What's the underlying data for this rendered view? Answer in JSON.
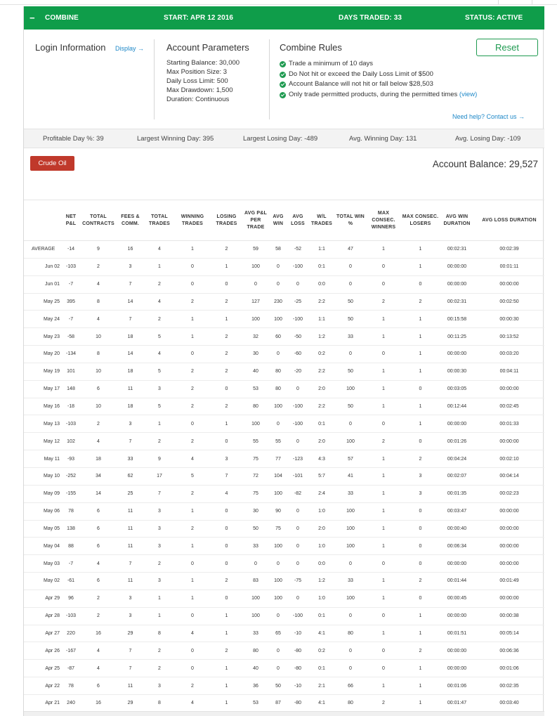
{
  "header": {
    "toggle_symbol": "−",
    "program": "COMBINE",
    "start": "START: APR 12 2016",
    "days_traded": "DAYS TRADED: 33",
    "status": "STATUS: ACTIVE"
  },
  "login": {
    "title": "Login Information",
    "display_link": "Display →"
  },
  "params": {
    "title": "Account Parameters",
    "lines": [
      "Starting Balance: 30,000",
      "Max Position Size: 3",
      "Daily Loss Limit: 500",
      "Max Drawdown: 1,500",
      "Duration: Continuous"
    ]
  },
  "rules": {
    "title": "Combine Rules",
    "items": [
      "Trade a minimum of 10 days",
      "Do Not hit or exceed the Daily Loss Limit of $500",
      "Account Balance will not hit or fall below $28,503",
      "Only trade permitted products, during the permitted times"
    ],
    "view_link": "(view)",
    "help_link": "Need help? Contact us →",
    "reset_label": "Reset"
  },
  "stats": {
    "profitable_day": "Profitable Day %: 39",
    "largest_win": "Largest Winning Day: 395",
    "largest_loss": "Largest Losing Day: -489",
    "avg_win": "Avg. Winning Day: 131",
    "avg_loss": "Avg. Losing Day: -109"
  },
  "product_button": "Crude Oil",
  "account_balance": "Account Balance: 29,527",
  "columns": [
    "",
    "NET P&L",
    "TOTAL CONTRACTS",
    "FEES & COMM.",
    "TOTAL TRADES",
    "WINNING TRADES",
    "LOSING TRADES",
    "AVG P&L PER TRADE",
    "AVG WIN",
    "AVG LOSS",
    "W/L TRADES",
    "TOTAL WIN %",
    "MAX CONSEC. WINNERS",
    "MAX CONSEC. LOSERS",
    "AVG WIN DURATION",
    "AVG LOSS DURATION"
  ],
  "rows": [
    [
      "AVERAGE",
      "-14",
      "9",
      "16",
      "4",
      "1",
      "2",
      "59",
      "58",
      "-52",
      "1:1",
      "47",
      "1",
      "1",
      "00:02:31",
      "00:02:39"
    ],
    [
      "Jun 02",
      "-103",
      "2",
      "3",
      "1",
      "0",
      "1",
      "100",
      "0",
      "-100",
      "0:1",
      "0",
      "0",
      "1",
      "00:00:00",
      "00:01:11"
    ],
    [
      "Jun 01",
      "-7",
      "4",
      "7",
      "2",
      "0",
      "0",
      "0",
      "0",
      "0",
      "0:0",
      "0",
      "0",
      "0",
      "00:00:00",
      "00:00:00"
    ],
    [
      "May 25",
      "395",
      "8",
      "14",
      "4",
      "2",
      "2",
      "127",
      "230",
      "-25",
      "2:2",
      "50",
      "2",
      "2",
      "00:02:31",
      "00:02:50"
    ],
    [
      "May 24",
      "-7",
      "4",
      "7",
      "2",
      "1",
      "1",
      "100",
      "100",
      "-100",
      "1:1",
      "50",
      "1",
      "1",
      "00:15:58",
      "00:00:30"
    ],
    [
      "May 23",
      "-58",
      "10",
      "18",
      "5",
      "1",
      "2",
      "32",
      "60",
      "-50",
      "1:2",
      "33",
      "1",
      "1",
      "00:11:25",
      "00:13:52"
    ],
    [
      "May 20",
      "-134",
      "8",
      "14",
      "4",
      "0",
      "2",
      "30",
      "0",
      "-60",
      "0:2",
      "0",
      "0",
      "1",
      "00:00:00",
      "00:03:20"
    ],
    [
      "May 19",
      "101",
      "10",
      "18",
      "5",
      "2",
      "2",
      "40",
      "80",
      "-20",
      "2:2",
      "50",
      "1",
      "1",
      "00:00:30",
      "00:04:11"
    ],
    [
      "May 17",
      "148",
      "6",
      "11",
      "3",
      "2",
      "0",
      "53",
      "80",
      "0",
      "2:0",
      "100",
      "1",
      "0",
      "00:03:05",
      "00:00:00"
    ],
    [
      "May 16",
      "-18",
      "10",
      "18",
      "5",
      "2",
      "2",
      "80",
      "100",
      "-100",
      "2:2",
      "50",
      "1",
      "1",
      "00:12:44",
      "00:02:45"
    ],
    [
      "May 13",
      "-103",
      "2",
      "3",
      "1",
      "0",
      "1",
      "100",
      "0",
      "-100",
      "0:1",
      "0",
      "0",
      "1",
      "00:00:00",
      "00:01:33"
    ],
    [
      "May 12",
      "102",
      "4",
      "7",
      "2",
      "2",
      "0",
      "55",
      "55",
      "0",
      "2:0",
      "100",
      "2",
      "0",
      "00:01:26",
      "00:00:00"
    ],
    [
      "May 11",
      "-93",
      "18",
      "33",
      "9",
      "4",
      "3",
      "75",
      "77",
      "-123",
      "4:3",
      "57",
      "1",
      "2",
      "00:04:24",
      "00:02:10"
    ],
    [
      "May 10",
      "-252",
      "34",
      "62",
      "17",
      "5",
      "7",
      "72",
      "104",
      "-101",
      "5:7",
      "41",
      "1",
      "3",
      "00:02:07",
      "00:04:14"
    ],
    [
      "May 09",
      "-155",
      "14",
      "25",
      "7",
      "2",
      "4",
      "75",
      "100",
      "-82",
      "2:4",
      "33",
      "1",
      "3",
      "00:01:35",
      "00:02:23"
    ],
    [
      "May 06",
      "78",
      "6",
      "11",
      "3",
      "1",
      "0",
      "30",
      "90",
      "0",
      "1:0",
      "100",
      "1",
      "0",
      "00:03:47",
      "00:00:00"
    ],
    [
      "May 05",
      "138",
      "6",
      "11",
      "3",
      "2",
      "0",
      "50",
      "75",
      "0",
      "2:0",
      "100",
      "1",
      "0",
      "00:00:40",
      "00:00:00"
    ],
    [
      "May 04",
      "88",
      "6",
      "11",
      "3",
      "1",
      "0",
      "33",
      "100",
      "0",
      "1:0",
      "100",
      "1",
      "0",
      "00:06:34",
      "00:00:00"
    ],
    [
      "May 03",
      "-7",
      "4",
      "7",
      "2",
      "0",
      "0",
      "0",
      "0",
      "0",
      "0:0",
      "0",
      "0",
      "0",
      "00:00:00",
      "00:00:00"
    ],
    [
      "May 02",
      "-61",
      "6",
      "11",
      "3",
      "1",
      "2",
      "83",
      "100",
      "-75",
      "1:2",
      "33",
      "1",
      "2",
      "00:01:44",
      "00:01:49"
    ],
    [
      "Apr 29",
      "96",
      "2",
      "3",
      "1",
      "1",
      "0",
      "100",
      "100",
      "0",
      "1:0",
      "100",
      "1",
      "0",
      "00:00:45",
      "00:00:00"
    ],
    [
      "Apr 28",
      "-103",
      "2",
      "3",
      "1",
      "0",
      "1",
      "100",
      "0",
      "-100",
      "0:1",
      "0",
      "0",
      "1",
      "00:00:00",
      "00:00:38"
    ],
    [
      "Apr 27",
      "220",
      "16",
      "29",
      "8",
      "4",
      "1",
      "33",
      "65",
      "-10",
      "4:1",
      "80",
      "1",
      "1",
      "00:01:51",
      "00:05:14"
    ],
    [
      "Apr 26",
      "-167",
      "4",
      "7",
      "2",
      "0",
      "2",
      "80",
      "0",
      "-80",
      "0:2",
      "0",
      "0",
      "2",
      "00:00:00",
      "00:06:36"
    ],
    [
      "Apr 25",
      "-87",
      "4",
      "7",
      "2",
      "0",
      "1",
      "40",
      "0",
      "-80",
      "0:1",
      "0",
      "0",
      "1",
      "00:00:00",
      "00:01:06"
    ],
    [
      "Apr 22",
      "78",
      "6",
      "11",
      "3",
      "2",
      "1",
      "36",
      "50",
      "-10",
      "2:1",
      "66",
      "1",
      "1",
      "00:01:06",
      "00:02:35"
    ],
    [
      "Apr 21",
      "240",
      "16",
      "29",
      "8",
      "4",
      "1",
      "53",
      "87",
      "-80",
      "4:1",
      "80",
      "2",
      "1",
      "00:01:47",
      "00:03:40"
    ]
  ]
}
